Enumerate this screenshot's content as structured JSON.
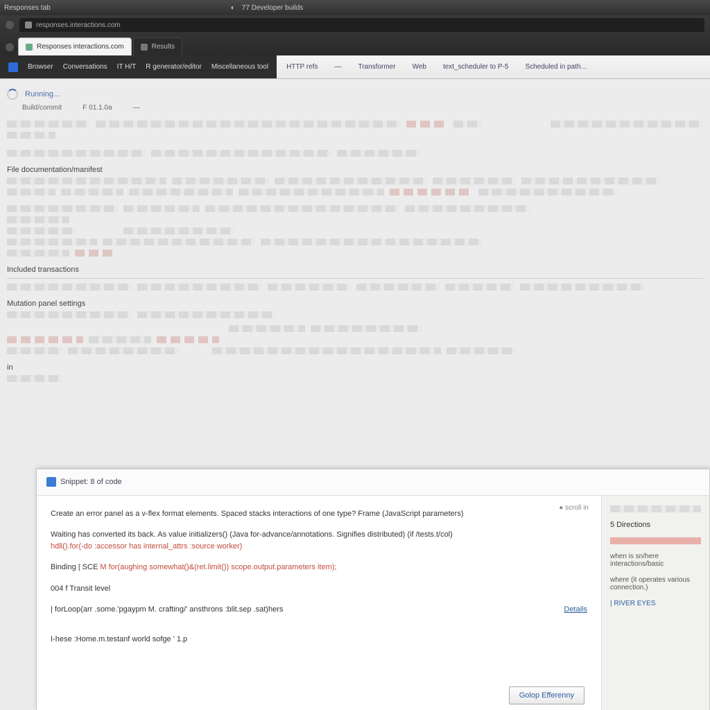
{
  "colors": {
    "accent": "#2d5ea0",
    "danger": "#c24a3a",
    "chrome_dark": "#2d2d2d"
  },
  "titlebar": {
    "left": "Responses tab",
    "right_a": "◐",
    "right_b": "77  Developer builds"
  },
  "urlbar": {
    "text": "responses.interactions.com"
  },
  "tabs": [
    {
      "label": "Responses interactions.com",
      "active": true
    },
    {
      "label": "Results",
      "active": false
    }
  ],
  "navbar_dark": [
    "Browser",
    "Conversations",
    "IT H/T",
    "R generator/editor",
    "Miscellaneous tool"
  ],
  "navbar_light": [
    "HTTP refs",
    "—",
    "Transformer",
    "Web",
    "text_scheduler to P-5",
    "Scheduled in path…"
  ],
  "page": {
    "loading_label": "Running…",
    "meta_a": "Build/commit",
    "meta_b": "F 01.1.0a",
    "meta_c": "—",
    "section1_title": "",
    "section2_title": "File   documentation/manifest",
    "section3_title": "Included transactions",
    "section4_title": "Mutation panel settings",
    "section5_title": "in"
  },
  "modal": {
    "title": "Snippet:  8 of code",
    "hint": "● scroll in",
    "line1": "Create an error panel as a v-flex format elements. Spaced stacks interactions of one type? Frame (JavaScript parameters)",
    "line2_a": "Waiting has converted its back.  As  value  initializers()  (Java  for-advance/annotations. Signifies distributed) (if  /tests.t/col)",
    "line2_b": "hdll().for(-do :accessor has internal_attrs :source worker)",
    "line3_a": "Binding   | SCE",
    "line3_b": "M  for(aughing somewhat()&(ret.limit()) scope.output.parameters  item);",
    "line4": "004  f Transit level",
    "line5": "|  forLoop(arr .some.'pgaypm   M. crafting/' ansthrons  :blit.sep .sat)hers",
    "line6": "I-hese :Home.m.testanf world  sofge  '   1.p",
    "details_link": "Details",
    "side_header": "5 Directions",
    "side_a": "when is  sn/here  interactions/basic",
    "side_b": "where  (it operates  various  connection.)",
    "side_c": "|  RIVER EYES",
    "footer_button": "Golop  Efferenny"
  }
}
